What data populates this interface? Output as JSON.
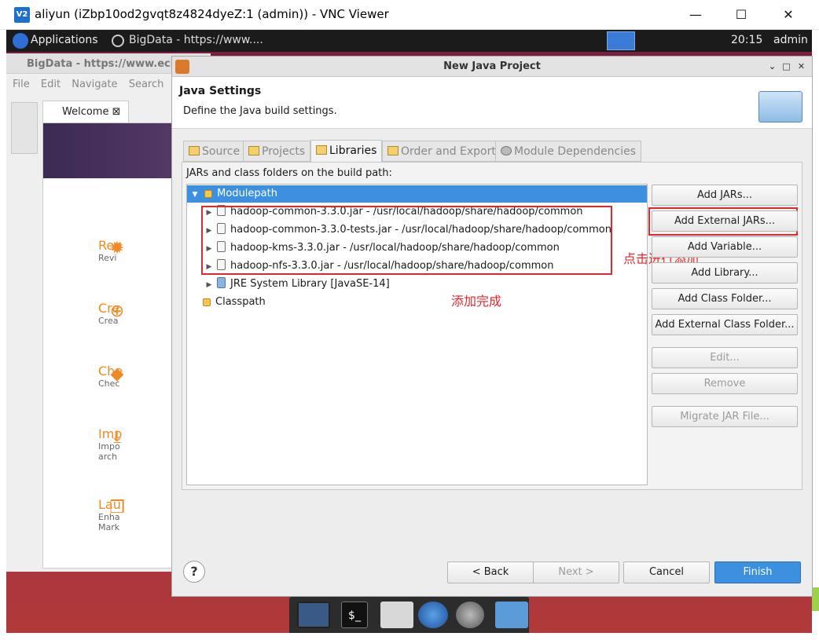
{
  "vnc": {
    "title": "aliyun (iZbp10od2gvqt8z4824dyeZ:1 (admin)) - VNC Viewer",
    "logo": "V2",
    "minimize": "—",
    "maximize": "☐",
    "close": "✕"
  },
  "panel": {
    "applications": "Applications",
    "task": "BigData - https://www....",
    "clock": "20:15",
    "user": "admin"
  },
  "eclipse": {
    "title": "BigData - https://www.ecl",
    "menu": [
      "File",
      "Edit",
      "Navigate",
      "Search"
    ],
    "welcome_tab": "Welcome",
    "items": [
      {
        "icon": "gear-icon",
        "title": "Rev",
        "sub": "Revi"
      },
      {
        "icon": "plus-circle-icon",
        "title": "Cre",
        "sub": "Crea"
      },
      {
        "icon": "git-icon",
        "title": "Che",
        "sub": "Chec"
      },
      {
        "icon": "download-icon",
        "title": "Imp",
        "sub": "Impo\narch"
      },
      {
        "icon": "box-icon",
        "title": "Lau",
        "sub": "Enha\nMark"
      }
    ]
  },
  "dialog": {
    "title": "New Java Project",
    "header_title": "Java Settings",
    "header_sub": "Define the Java build settings.",
    "tabs": [
      "Source",
      "Projects",
      "Libraries",
      "Order and Export",
      "Module Dependencies"
    ],
    "active_tab": "Libraries",
    "list_label": "JARs and class folders on the build path:",
    "tree": {
      "modulepath": "Modulepath",
      "jars": [
        "hadoop-common-3.3.0.jar - /usr/local/hadoop/share/hadoop/common",
        "hadoop-common-3.3.0-tests.jar - /usr/local/hadoop/share/hadoop/common",
        "hadoop-kms-3.3.0.jar - /usr/local/hadoop/share/hadoop/common",
        "hadoop-nfs-3.3.0.jar - /usr/local/hadoop/share/hadoop/common"
      ],
      "jre": "JRE System Library [JavaSE-14]",
      "classpath": "Classpath"
    },
    "buttons": {
      "add_jars": "Add JARs...",
      "add_external_jars": "Add External JARs...",
      "add_variable": "Add Variable...",
      "add_library": "Add Library...",
      "add_class_folder": "Add Class Folder...",
      "add_external_class_folder": "Add External Class Folder...",
      "edit": "Edit...",
      "remove": "Remove",
      "migrate": "Migrate JAR File..."
    },
    "annotations": {
      "click_add": "点击进行添加",
      "added_done": "添加完成"
    },
    "footer": {
      "help": "?",
      "back": "< Back",
      "next": "Next >",
      "cancel": "Cancel",
      "finish": "Finish"
    }
  },
  "dock": {
    "terminal": "$_"
  }
}
